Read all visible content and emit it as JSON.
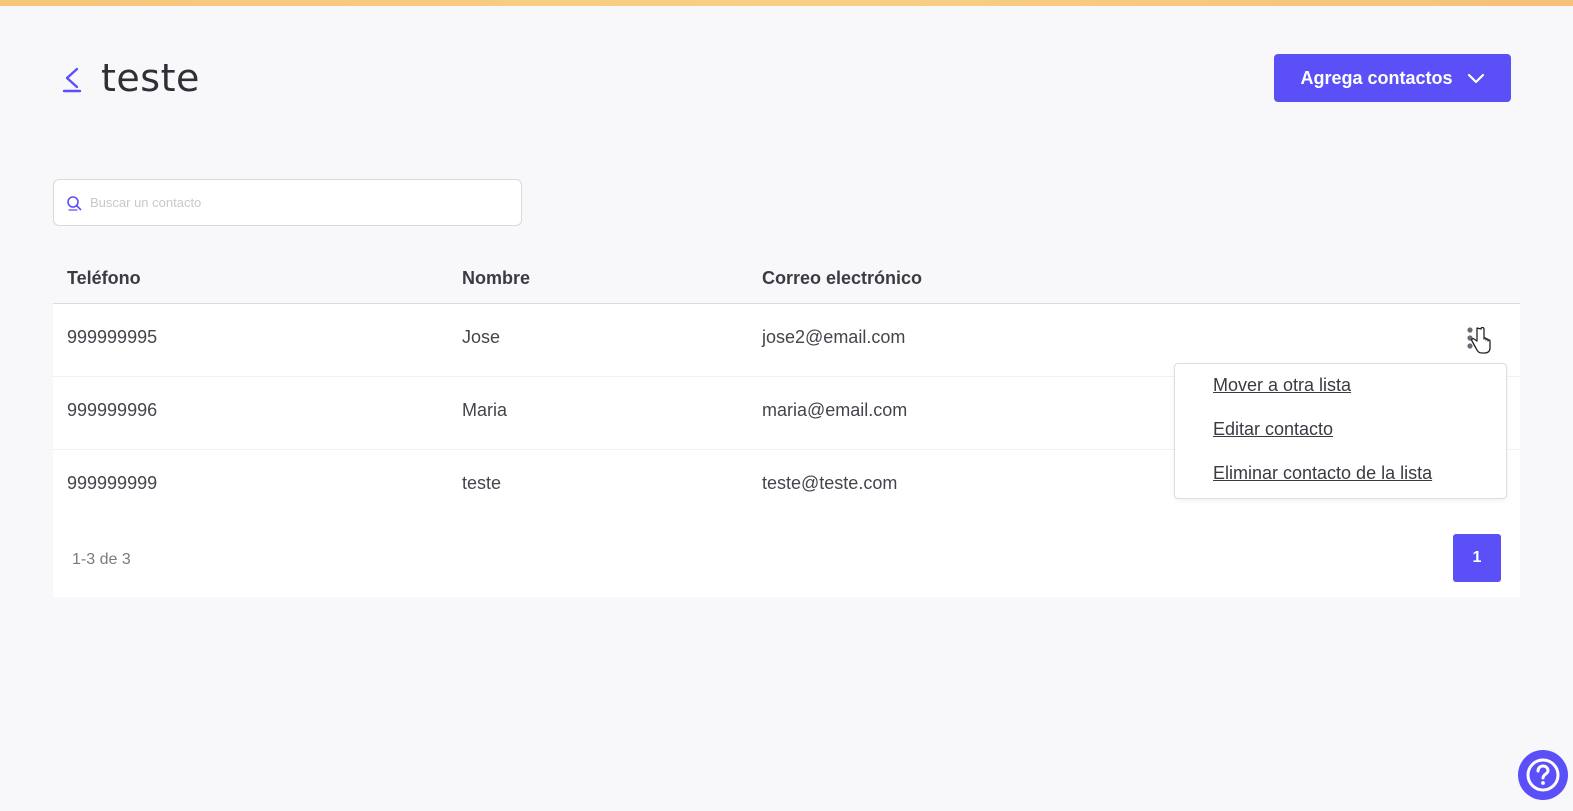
{
  "colors": {
    "accent": "#5b4ff7",
    "top_bar": "#f9cf86",
    "background": "#f8f8fa"
  },
  "header": {
    "back_icon": "chevron-left-icon",
    "title": "teste",
    "add_button_label": "Agrega contactos",
    "add_button_icon": "chevron-down-icon"
  },
  "search": {
    "placeholder": "Buscar un contacto",
    "value": "",
    "icon": "search-icon"
  },
  "table": {
    "columns": [
      "Teléfono",
      "Nombre",
      "Correo electrónico"
    ],
    "rows": [
      {
        "phone": "999999995",
        "name": "Jose",
        "email": "jose2@email.com"
      },
      {
        "phone": "999999996",
        "name": "Maria",
        "email": "maria@email.com"
      },
      {
        "phone": "999999999",
        "name": "teste",
        "email": "teste@teste.com"
      }
    ]
  },
  "row_menu": {
    "icon": "more-vertical-icon",
    "items": [
      "Mover a otra lista",
      "Editar contacto",
      "Eliminar contacto de la lista"
    ]
  },
  "pagination": {
    "range_text": "1-3 de 3",
    "current_page": "1"
  },
  "help": {
    "icon": "help-circle-icon"
  }
}
